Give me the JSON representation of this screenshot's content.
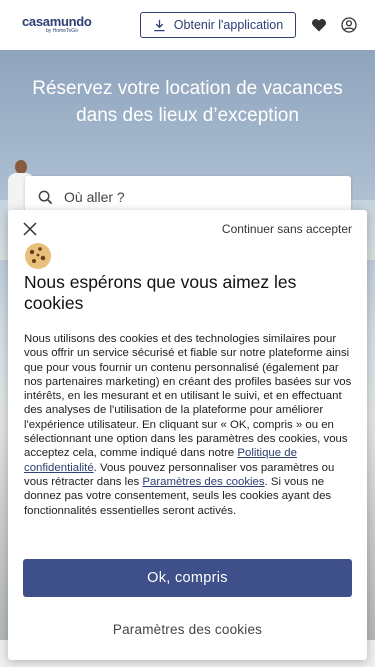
{
  "header": {
    "logo_text": "casamundo",
    "logo_sub": "by HomeToGo",
    "app_button_label": "Obtenir l'application",
    "icons": [
      "download-icon",
      "heart-icon",
      "user-icon"
    ]
  },
  "hero": {
    "title": "Réservez votre location de vacances dans des lieux d’exception",
    "search_placeholder": "Où aller ?"
  },
  "cookie_dialog": {
    "continue_label": "Continuer sans accepter",
    "title": "Nous espérons que vous aimez les cookies",
    "body_part1": "Nous utilisons des cookies et des technologies similaires pour vous offrir un service sécurisé et fiable sur notre plateforme ainsi que pour vous fournir un contenu personnalisé (également par nos partenaires marketing) en créant des profiles basées sur vos intérêts, en les mesurant et en utilisant le suivi, et en effectuant des analyses de l'utilisation de la plateforme pour améliorer l'expérience utilisateur. En cliquant sur « OK, compris » ou en sélectionnant une option dans les paramètres des cookies, vous acceptez cela, comme indiqué dans notre ",
    "privacy_link": "Politique de confidentialité",
    "body_part2": ". Vous pouvez personnaliser vos paramètres ou vous rétracter dans les ",
    "settings_link": "Paramètres des cookies",
    "body_part3": ". Si vous ne donnez pas votre consentement, seuls les cookies ayant des fonctionnalités essentielles seront activés.",
    "ok_label": "Ok, compris",
    "settings_label": "Paramètres des cookies"
  },
  "colors": {
    "brand": "#2e4074",
    "primary_button": "#3e4f8a",
    "accent_sun": "#f5b731"
  }
}
